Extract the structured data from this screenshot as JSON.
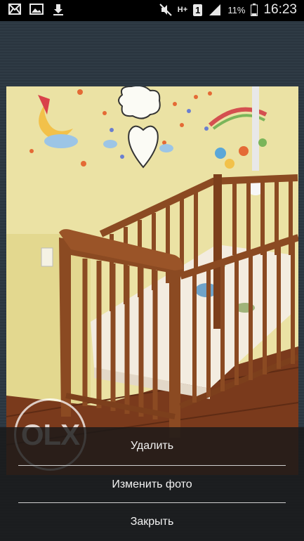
{
  "status_bar": {
    "battery_percent": "11%",
    "time": "16:23",
    "sim_badge": "1",
    "network": "H+",
    "icons": [
      "mail-icon",
      "image-icon",
      "download-icon",
      "mute-icon",
      "network-icon",
      "sim-icon",
      "signal-icon",
      "battery-icon"
    ]
  },
  "photo": {
    "watermark": "OLX",
    "subject": "baby-crib-photo"
  },
  "sheet": {
    "delete_label": "Удалить",
    "change_photo_label": "Изменить фото",
    "close_label": "Закрыть"
  },
  "colors": {
    "status_bar_bg": "#000000",
    "background": "#2c3741",
    "sheet_bg": "#191919",
    "wall": "#e9df9f",
    "crib_wood": "#8b4a22"
  }
}
